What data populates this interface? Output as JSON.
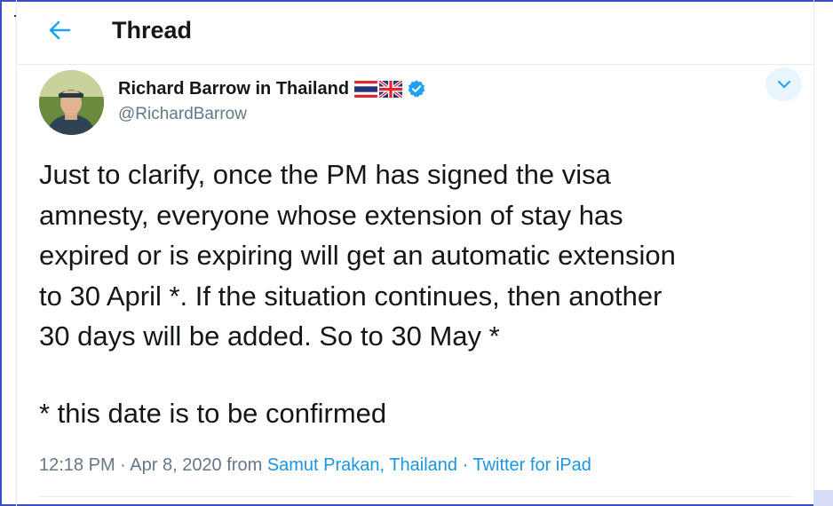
{
  "header": {
    "back_icon": "arrow-left-icon",
    "title": "Thread"
  },
  "tweet": {
    "author_name": "Richard Barrow in Thailand",
    "flags": [
      "thailand-flag-icon",
      "uk-flag-icon"
    ],
    "verified_icon": "verified-badge-icon",
    "handle": "@RichardBarrow",
    "menu_icon": "chevron-down-icon",
    "text_lines": [
      "Just to clarify, once the PM has signed the visa",
      "amnesty, everyone whose extension of stay has",
      "expired or is expiring will get an automatic extension",
      "to 30 April *. If the situation continues, then another",
      "30 days will be added. So to 30 May *"
    ],
    "footnote": "* this date is to be confirmed",
    "time": "12:18 PM · Apr 8, 2020",
    "from_label": " from ",
    "location": "Samut Prakan, Thailand",
    "separator": " · ",
    "source": "Twitter for iPad"
  },
  "colors": {
    "accent": "#1da1f2",
    "link": "#1b95e0",
    "secondary_text": "#657786",
    "primary_text": "#14171a",
    "border": "#e6ecf0"
  }
}
